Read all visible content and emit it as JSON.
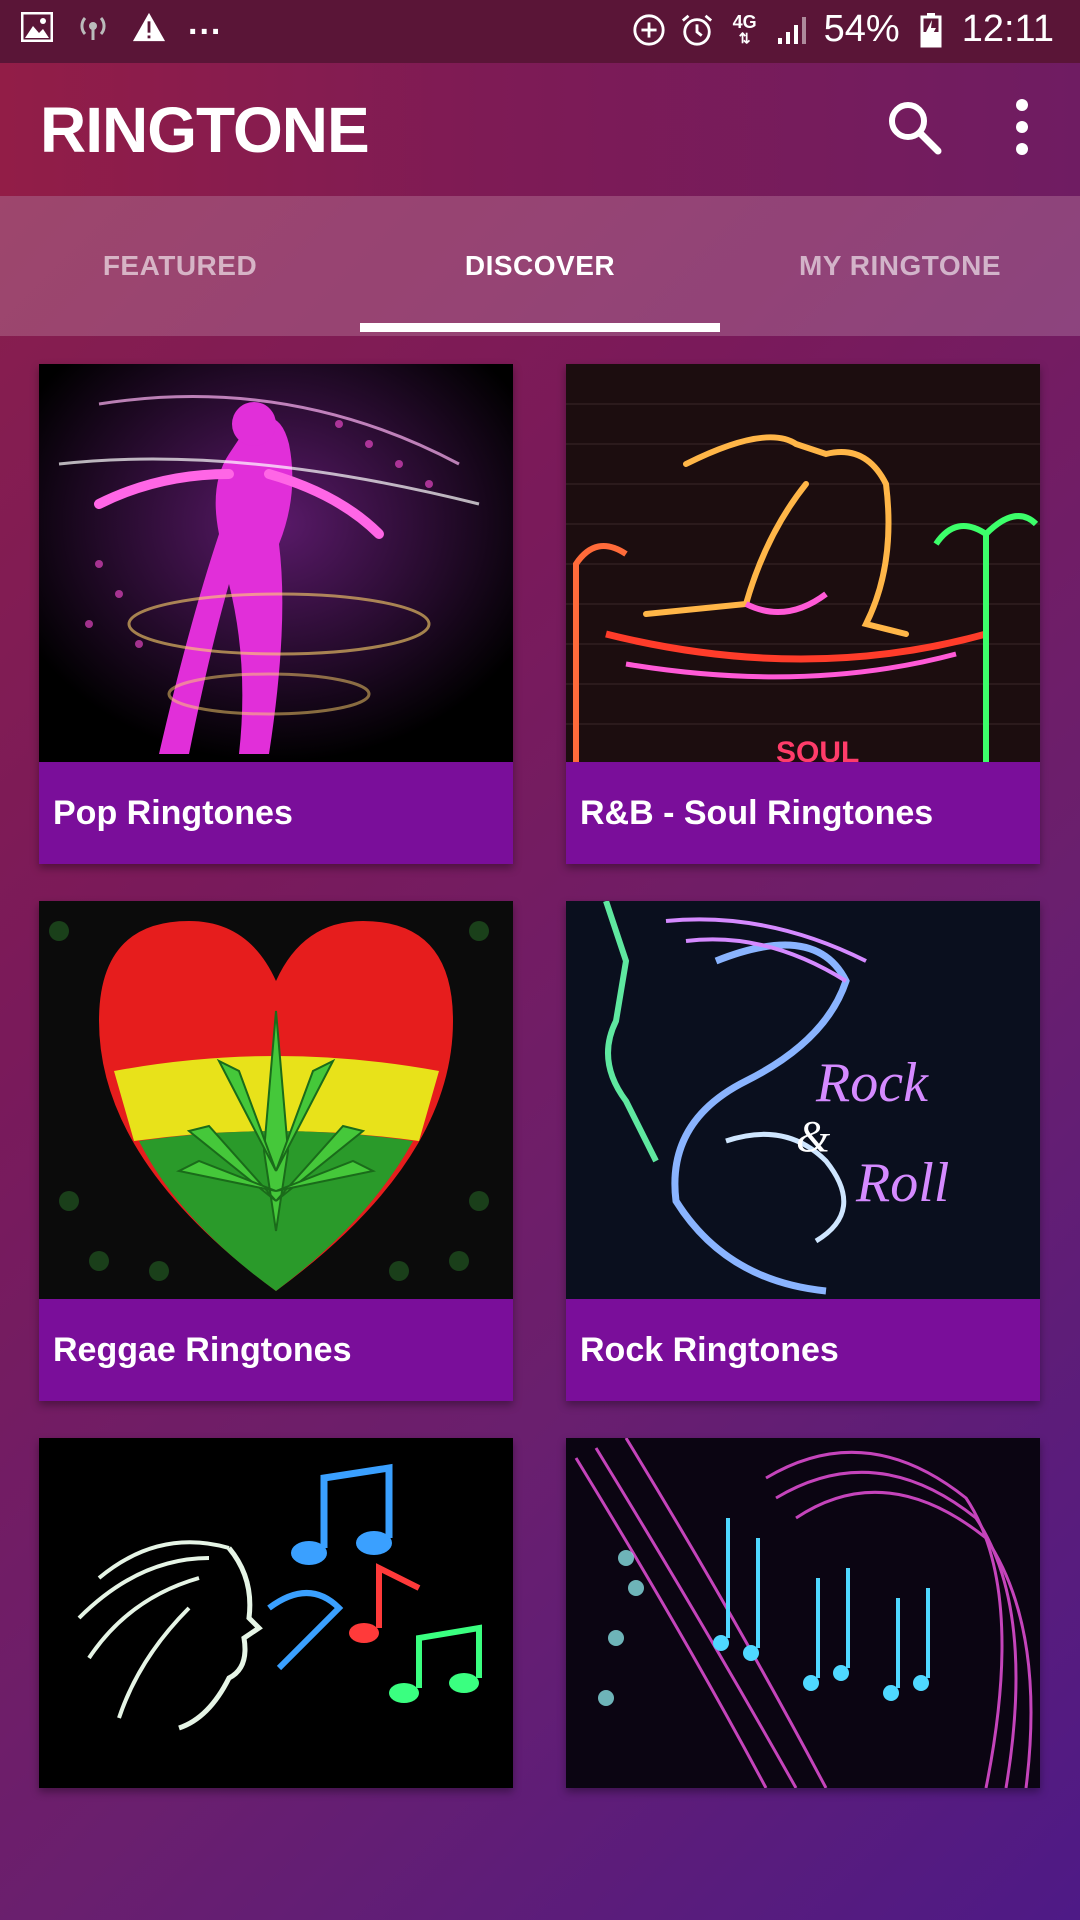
{
  "status_bar": {
    "battery": "54%",
    "time": "12:11",
    "network": "4G",
    "left_icons": [
      "image-icon",
      "hotspot-icon",
      "warning-icon"
    ],
    "more": "..."
  },
  "app_bar": {
    "title": "RINGTONE",
    "icons": [
      "search-icon",
      "more-vert-icon"
    ]
  },
  "tabs": [
    {
      "label": "FEATURED",
      "selected": false
    },
    {
      "label": "DISCOVER",
      "selected": true
    },
    {
      "label": "MY RINGTONE",
      "selected": false
    }
  ],
  "categories": [
    {
      "label": "Pop Ringtones"
    },
    {
      "label": "R&B - Soul Ringtones"
    },
    {
      "label": "Reggae Ringtones"
    },
    {
      "label": "Rock Ringtones"
    },
    {
      "label": ""
    },
    {
      "label": ""
    }
  ],
  "colors": {
    "status_bar": "#5a1537",
    "app_bar": "#8a1c4e",
    "card_label": "#7a0e9a",
    "tab_indicator": "#ffffff"
  }
}
